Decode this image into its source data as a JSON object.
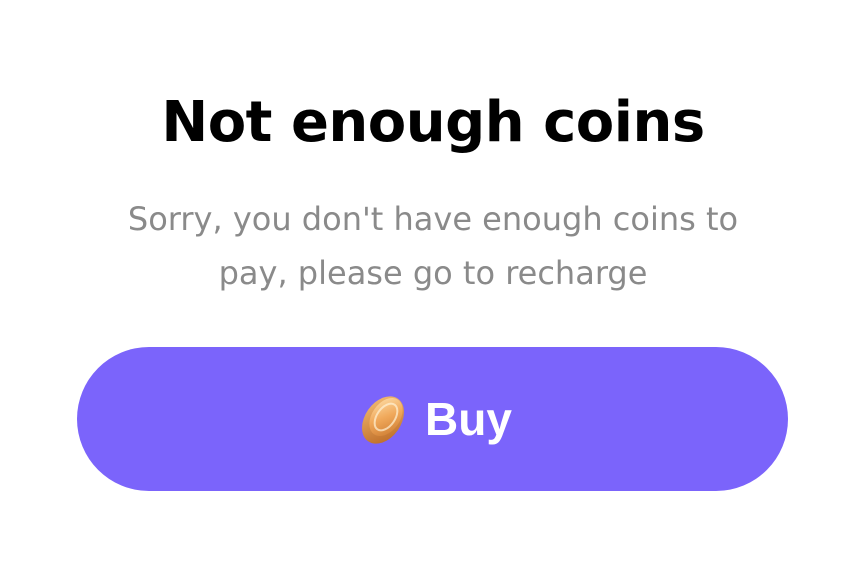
{
  "dialog": {
    "title": "Not enough coins",
    "message": "Sorry, you don't have enough coins to pay, please go to recharge",
    "buy_button": {
      "label": "Buy",
      "icon": "coin-icon"
    }
  },
  "colors": {
    "accent": "#7b64fb",
    "title": "#000000",
    "message": "#8a8a8a",
    "button_text": "#ffffff",
    "background": "#ffffff"
  }
}
